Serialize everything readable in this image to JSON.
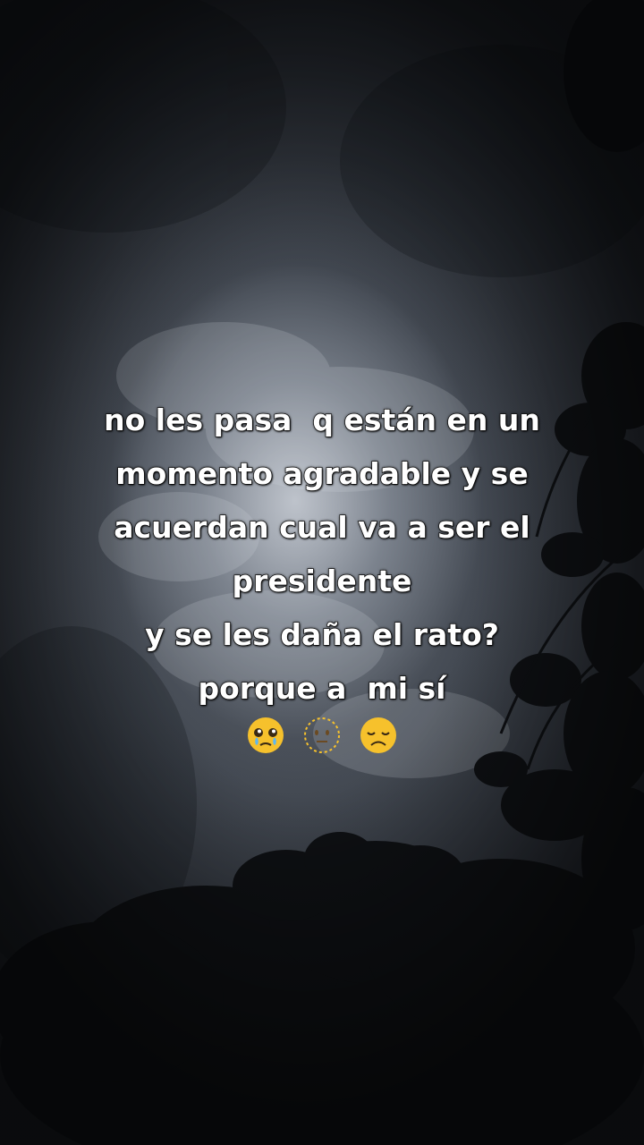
{
  "caption": {
    "lines": [
      "no les pasa  q están en un",
      "momento agradable y se",
      "acuerdan cual va a ser el",
      "presidente",
      "y se les daña el rato?",
      "porque a  mi sí"
    ],
    "emojis": [
      "pleading-face-with-tears-icon",
      "dotted-line-face-icon",
      "disappointed-face-icon"
    ]
  },
  "colors": {
    "text": "#ffffff",
    "text_outline": "#1a1a1a",
    "sky_light": "#cdd2da",
    "sky_dark": "#15181d",
    "foliage": "#0e1013",
    "emoji_yellow": "#f6c12c"
  }
}
